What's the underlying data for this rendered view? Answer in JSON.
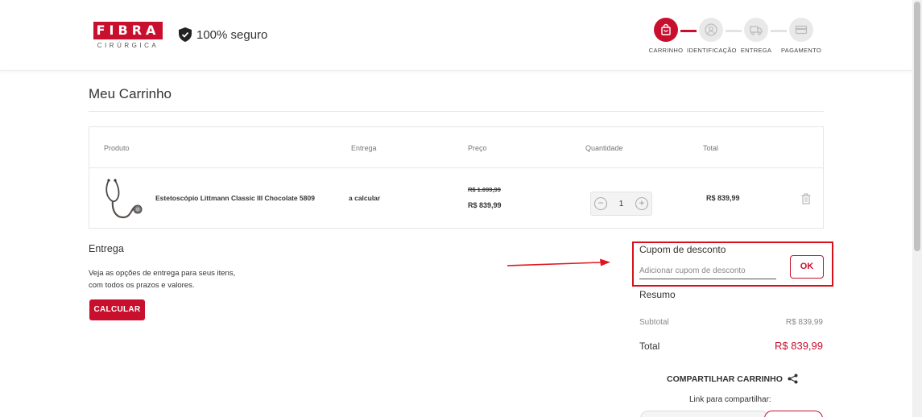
{
  "header": {
    "logo_main": "FIBRA",
    "logo_sub": "CIRÚRGICA",
    "secure_label": "100% seguro",
    "steps": [
      {
        "label": "CARRINHO",
        "icon": "bag-icon",
        "active": true
      },
      {
        "label": "IDENTIFICAÇÃO",
        "icon": "user-icon",
        "active": false
      },
      {
        "label": "ENTREGA",
        "icon": "truck-icon",
        "active": false
      },
      {
        "label": "PAGAMENTO",
        "icon": "card-icon",
        "active": false
      }
    ]
  },
  "page": {
    "title": "Meu Carrinho"
  },
  "table": {
    "headers": {
      "product": "Produto",
      "delivery": "Entrega",
      "price": "Preço",
      "quantity": "Quantidade",
      "total": "Total"
    },
    "rows": [
      {
        "name": "Estetoscópio Littmann Classic III Chocolate 5809",
        "delivery": "a calcular",
        "old_price": "R$ 1.099,99",
        "price": "R$ 839,99",
        "quantity": "1",
        "total": "R$ 839,99"
      }
    ]
  },
  "delivery_section": {
    "title": "Entrega",
    "line1": "Veja as opções de entrega para seus itens,",
    "line2": "com todos os prazos e valores.",
    "button": "CALCULAR"
  },
  "coupon": {
    "title": "Cupom de desconto",
    "placeholder": "Adicionar cupom de desconto",
    "button": "OK"
  },
  "summary": {
    "title": "Resumo",
    "subtotal_label": "Subtotal",
    "subtotal_value": "R$ 839,99",
    "total_label": "Total",
    "total_value": "R$ 839,99"
  },
  "share": {
    "title": "COMPARTILHAR CARRINHO",
    "link_label": "Link para compartilhar:"
  },
  "colors": {
    "brand": "#c8102e",
    "highlight": "#d8101b"
  }
}
